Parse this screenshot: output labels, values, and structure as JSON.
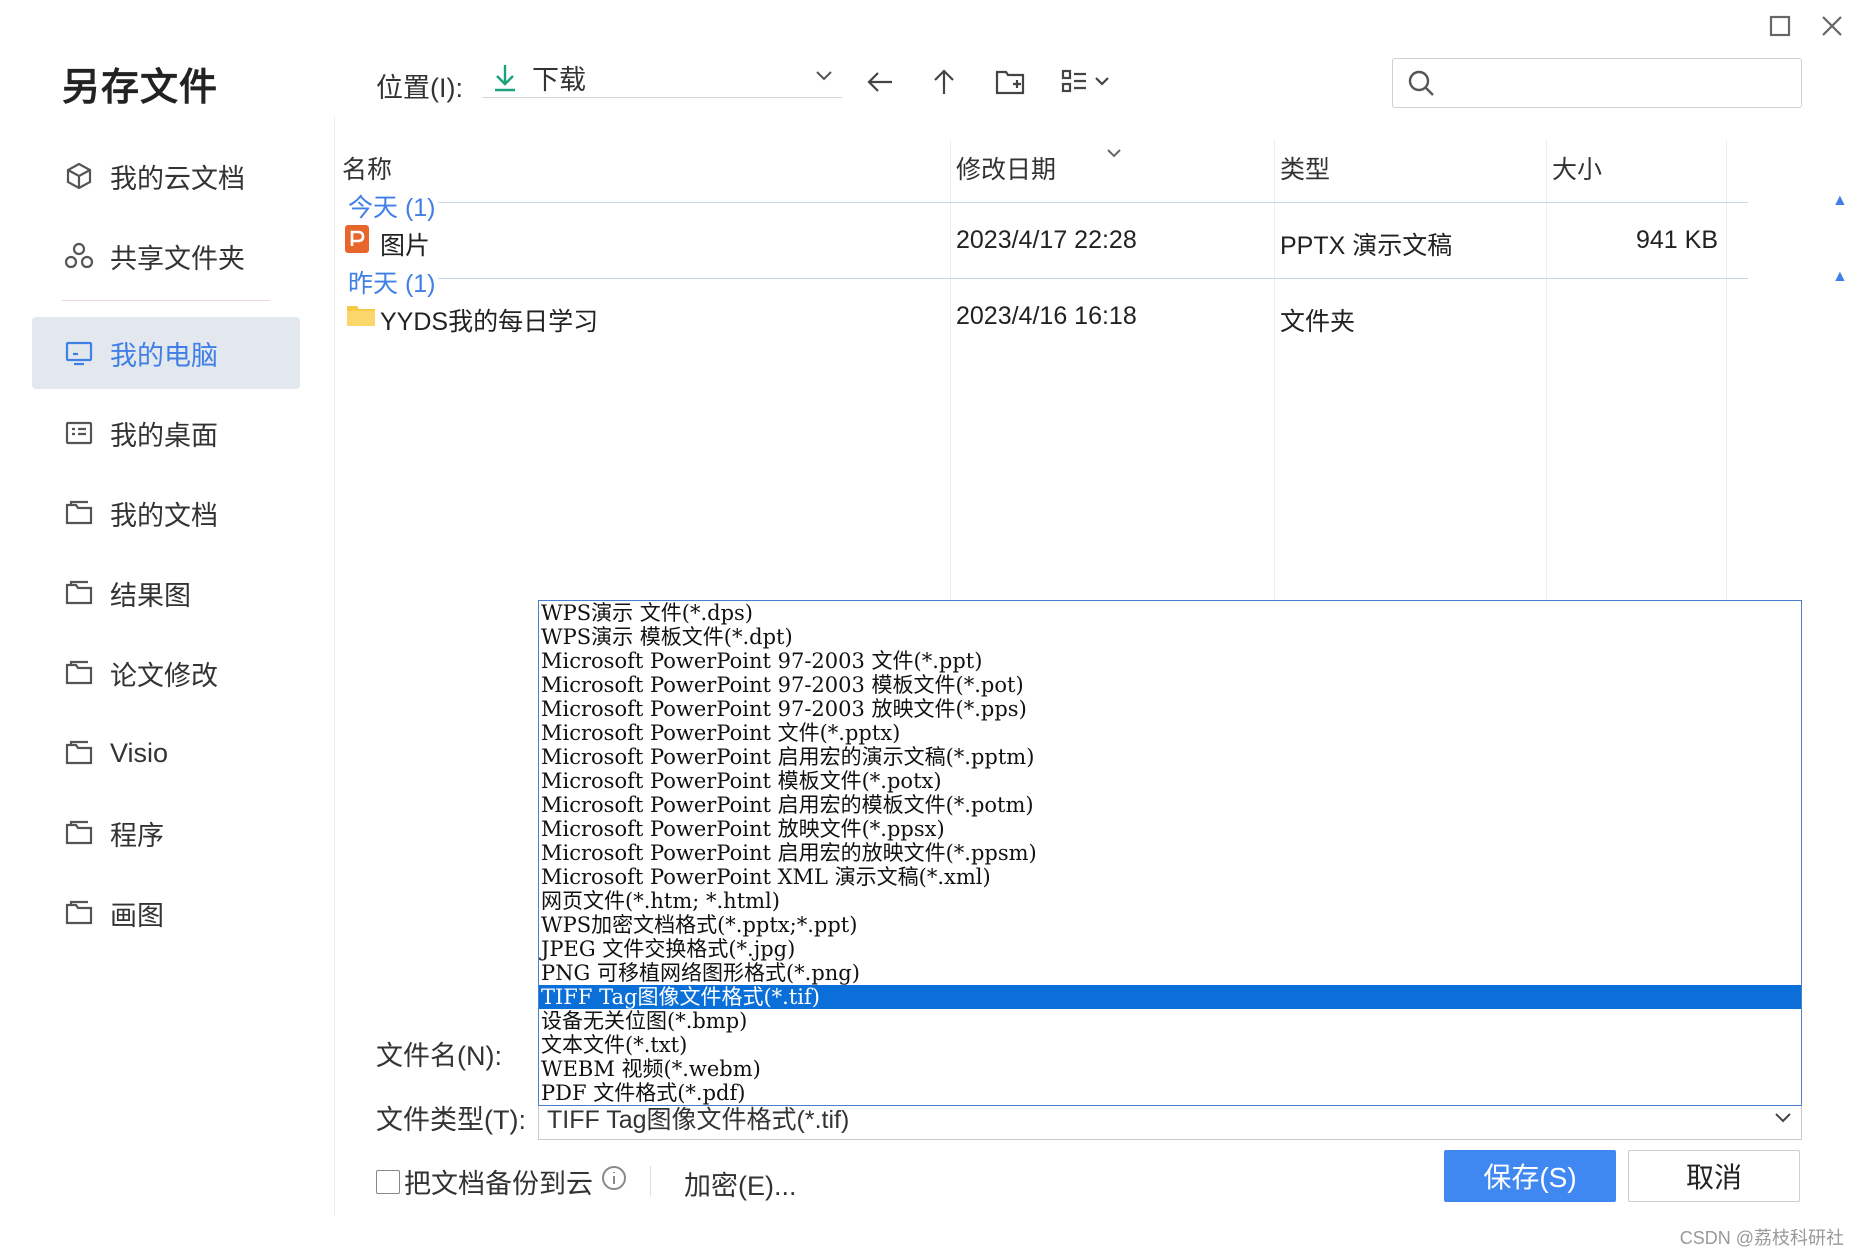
{
  "dialog": {
    "title": "另存文件"
  },
  "sidebar": {
    "items": [
      {
        "label": "我的云文档",
        "icon": "cloud-cube-icon"
      },
      {
        "label": "共享文件夹",
        "icon": "share-icon"
      },
      {
        "label": "我的电脑",
        "icon": "monitor-icon",
        "active": true
      },
      {
        "label": "我的桌面",
        "icon": "desktop-icon"
      },
      {
        "label": "我的文档",
        "icon": "folder-icon"
      },
      {
        "label": "结果图",
        "icon": "folder-icon"
      },
      {
        "label": "论文修改",
        "icon": "folder-icon"
      },
      {
        "label": "Visio",
        "icon": "folder-icon"
      },
      {
        "label": "程序",
        "icon": "folder-icon"
      },
      {
        "label": "画图",
        "icon": "folder-icon"
      }
    ]
  },
  "toolbar": {
    "location_label": "位置(I):",
    "location_value": "下载",
    "search_placeholder": ""
  },
  "list": {
    "headers": {
      "name": "名称",
      "date": "修改日期",
      "type": "类型",
      "size": "大小"
    },
    "groups": [
      {
        "label": "今天 (1)"
      },
      {
        "label": "昨天 (1)"
      }
    ],
    "rows": [
      {
        "name": "图片",
        "date": "2023/4/17 22:28",
        "type": "PPTX 演示文稿",
        "size": "941 KB",
        "icon": "pptx-file-icon"
      },
      {
        "name": "YYDS我的每日学习",
        "date": "2023/4/16 16:18",
        "type": "文件夹",
        "size": "",
        "icon": "folder-icon"
      }
    ]
  },
  "form": {
    "filename_label": "文件名(N):",
    "filetype_label": "文件类型(T):",
    "filetype_value": "TIFF Tag图像文件格式(*.tif)",
    "options": [
      "WPS演示 文件(*.dps)",
      "WPS演示 模板文件(*.dpt)",
      "Microsoft PowerPoint 97-2003 文件(*.ppt)",
      "Microsoft PowerPoint 97-2003 模板文件(*.pot)",
      "Microsoft PowerPoint 97-2003 放映文件(*.pps)",
      "Microsoft PowerPoint 文件(*.pptx)",
      "Microsoft PowerPoint 启用宏的演示文稿(*.pptm)",
      "Microsoft PowerPoint 模板文件(*.potx)",
      "Microsoft PowerPoint 启用宏的模板文件(*.potm)",
      "Microsoft PowerPoint 放映文件(*.ppsx)",
      "Microsoft PowerPoint 启用宏的放映文件(*.ppsm)",
      "Microsoft PowerPoint XML 演示文稿(*.xml)",
      "网页文件(*.htm; *.html)",
      "WPS加密文档格式(*.pptx;*.ppt)",
      "JPEG 文件交换格式(*.jpg)",
      "PNG 可移植网络图形格式(*.png)",
      "TIFF Tag图像文件格式(*.tif)",
      "设备无关位图(*.bmp)",
      "文本文件(*.txt)",
      "WEBM 视频(*.webm)",
      "PDF 文件格式(*.pdf)"
    ],
    "selected_option": "TIFF Tag图像文件格式(*.tif)"
  },
  "footer": {
    "backup_label": "把文档备份到云",
    "encrypt_label": "加密(E)...",
    "save_label": "保存(S)",
    "cancel_label": "取消"
  },
  "watermark": "CSDN @荔枝科研社",
  "colors": {
    "accent": "#3f7fe6",
    "save_button": "#3f88f2",
    "selection": "#0a6fd8",
    "download_icon": "#1aa37a"
  }
}
